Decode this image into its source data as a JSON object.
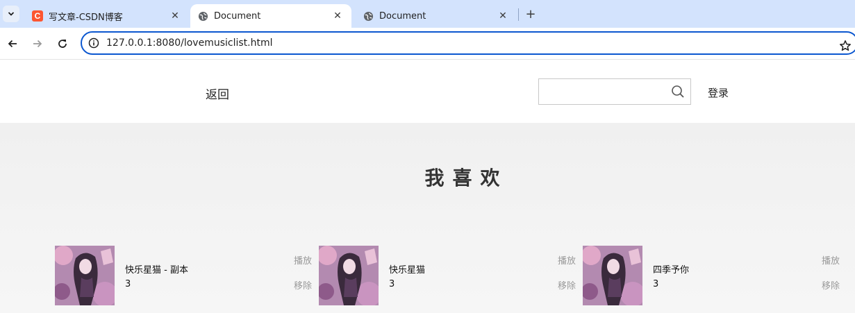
{
  "browser": {
    "tabs": [
      {
        "title": "写文章-CSDN博客",
        "favicon": "csdn-favicon",
        "active": false
      },
      {
        "title": "Document",
        "favicon": "globe-icon",
        "active": true
      },
      {
        "title": "Document",
        "favicon": "globe-icon",
        "active": false
      }
    ],
    "url": "127.0.0.1:8080/lovemusiclist.html",
    "accent_color": "#0b57d0",
    "tabstrip_color": "#d3e3fd"
  },
  "header": {
    "back_label": "返回",
    "search_value": "",
    "login_label": "登录"
  },
  "main": {
    "title": "我喜欢",
    "songs": [
      {
        "name": "快乐星猫 - 副本",
        "count": "3",
        "play_label": "播放",
        "remove_label": "移除"
      },
      {
        "name": "快乐星猫",
        "count": "3",
        "play_label": "播放",
        "remove_label": "移除"
      },
      {
        "name": "四季予你",
        "count": "3",
        "play_label": "播放",
        "remove_label": "移除"
      }
    ]
  }
}
